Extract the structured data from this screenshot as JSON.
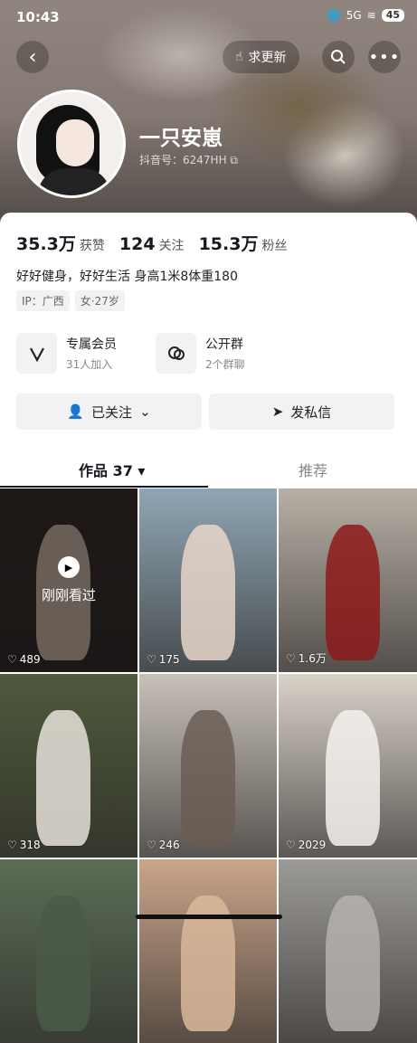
{
  "status": {
    "time": "10:43",
    "signal": "5G",
    "battery": "45"
  },
  "header": {
    "request_update": "求更新"
  },
  "profile": {
    "name": "一只安崽",
    "douyin_id": "抖音号：6247HH"
  },
  "stats": [
    {
      "value": "35.3万",
      "label": "获赞"
    },
    {
      "value": "124",
      "label": "关注"
    },
    {
      "value": "15.3万",
      "label": "粉丝"
    }
  ],
  "bio": "好好健身，好好生活 身高1米8体重180",
  "tags": [
    "IP：广西",
    "女·27岁"
  ],
  "features": [
    {
      "title": "专属会员",
      "sub": "31人加入",
      "icon": "v-icon"
    },
    {
      "title": "公开群",
      "sub": "2个群聊",
      "icon": "chat-group-icon"
    }
  ],
  "actions": {
    "followed": "已关注",
    "message": "发私信"
  },
  "tabs": {
    "works": "作品 37",
    "recommend": "推荐"
  },
  "videos": [
    {
      "likes": "489",
      "overlay": "刚刚看过",
      "bg": "#3a302c",
      "p": "#d8c2b0"
    },
    {
      "likes": "175",
      "bg": "#8fa6b4",
      "p": "#e7d6c9"
    },
    {
      "likes": "1.6万",
      "bg": "#b8b0a6",
      "p": "#8b1a1a"
    },
    {
      "likes": "318",
      "bg": "#4e5a3c",
      "p": "#e8e2da"
    },
    {
      "likes": "246",
      "bg": "#c7c1b8",
      "p": "#6a5d55"
    },
    {
      "likes": "2029",
      "bg": "#d9d2c9",
      "p": "#f4f2ee"
    },
    {
      "likes": "",
      "bg": "#5a6e55",
      "p": "#4b5a48"
    },
    {
      "likes": "",
      "bg": "#c9a58a",
      "p": "#d9b89b"
    },
    {
      "likes": "",
      "bg": "#9c9a96",
      "p": "#b4b2ae"
    }
  ]
}
